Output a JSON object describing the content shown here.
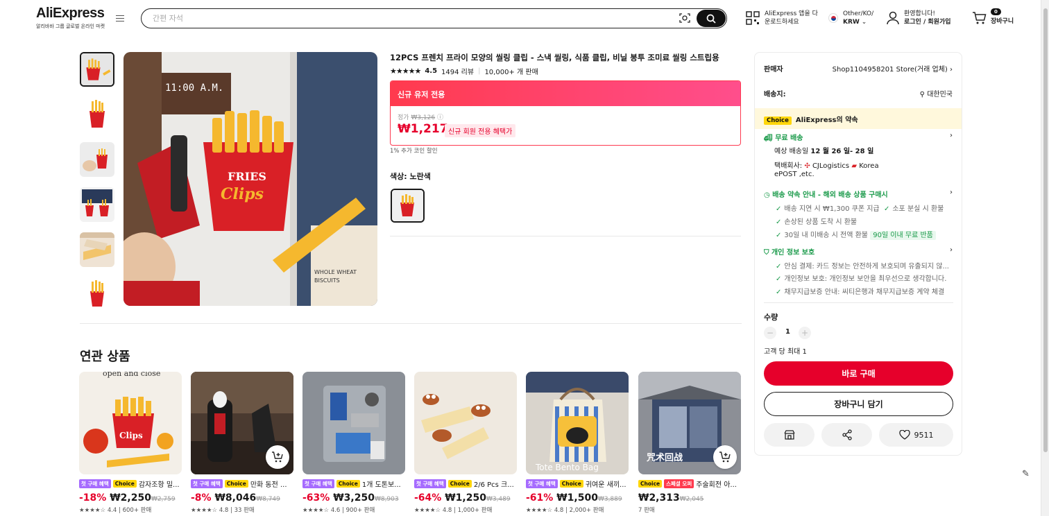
{
  "header": {
    "logo": "AliExpress",
    "logo_sub": "알리바바 그룹 글로벌 온라인 마켓",
    "search_placeholder": "간편 자석",
    "app_line1": "AliExpress 앱을 다",
    "app_line2": "운로드하세요",
    "locale_line1": "Other/KO/",
    "locale_currency": "KRW",
    "welcome": "환영합니다!",
    "login": "로그인 / 회원가입",
    "cart_count": "0",
    "cart_label": "장바구니"
  },
  "product": {
    "title": "12PCS 프렌치 프라이 모양의 씰링 클립 - 스낵 씰링, 식품 클립, 비닐 봉투 조미료 씰링 스트립용",
    "stars": "★★★★★",
    "rating": "4.5",
    "reviews": "1494 리뷰",
    "sold": "10,000+ 개 판매",
    "promo_banner": "신규 유저 전용",
    "orig_label": "정가",
    "orig_price": "₩3,126",
    "price": "₩1,217",
    "price_label": "신규 회원 전용 혜택가",
    "coin_text": "1% 추가 코인 할인",
    "color_label": "색상: 노란색"
  },
  "sidebar": {
    "seller_label": "판매자",
    "seller_value": "Shop1104958201 Store(거래 업체)",
    "shipto_label": "배송지:",
    "shipto_value": "대한민국",
    "choice_badge": "Choice",
    "choice_text": "AliExpress의 약속",
    "free_ship": "무료 배송",
    "delivery_prefix": "예상 배송일",
    "delivery_date": "12 월 26 일- 28 일",
    "courier_label": "택배회사:",
    "courier1": "CJLogistics",
    "courier2": "Korea",
    "courier3": "ePOST ,etc.",
    "guarantee_title": "배송 약속 안내 - 해외 배송 상품 구매시",
    "g1": "배송 지연 시 ₩1,300 쿠폰 지급",
    "g2": "소포 분실 시 환불",
    "g3": "손상된 상품 도착 시 환불",
    "g4": "30일 내 미배송 시 전액 환불",
    "g4_badge": "90일 이내 무료 반품",
    "privacy_title": "개인 정보 보호",
    "p1": "안심 결제: 카드 정보는 안전하게 보호되며 유출되지 않...",
    "p2": "개인정보 보호: 개인정보 보안을 최우선으로 생각합니다.",
    "p3": "채무지급보증 안내: 씨티은행과 채무지급보증 계약 체결",
    "qty_label": "수량",
    "qty_value": "1",
    "max_text": "고객 당 최대 1",
    "buy_now": "바로 구매",
    "add_cart": "장바구니 담기",
    "wishlist_count": "9511"
  },
  "related": {
    "title": "연관 상품",
    "items": [
      {
        "tag1": "첫 구매 혜택",
        "tag2": "Choice",
        "name": "감자조항 밀...",
        "discount": "-18%",
        "price": "₩2,250",
        "orig": "₩2,759",
        "rating": "4.4 | 600+ 판매"
      },
      {
        "tag1": "첫 구매 혜택",
        "tag2": "Choice",
        "name": "만화 동전 ...",
        "discount": "-8%",
        "price": "₩8,046",
        "orig": "₩8,749",
        "rating": "4.8 | 33 판매"
      },
      {
        "tag1": "첫 구매 혜택",
        "tag2": "Choice",
        "name": "1개 도톤보...",
        "discount": "-63%",
        "price": "₩3,250",
        "orig": "₩8,903",
        "rating": "4.6 | 900+ 판매"
      },
      {
        "tag1": "첫 구매 혜택",
        "tag2": "Choice",
        "name": "2/6 Pcs 크...",
        "discount": "-64%",
        "price": "₩1,250",
        "orig": "₩3,489",
        "rating": "4.8 | 1,000+ 판매"
      },
      {
        "tag1": "첫 구매 혜택",
        "tag2": "Choice",
        "name": "귀여운 새끼...",
        "discount": "-61%",
        "price": "₩1,500",
        "orig": "₩3,889",
        "rating": "4.8 | 2,000+ 판매"
      },
      {
        "tag1": "Choice",
        "tag2": "스페셜 오퍼",
        "name": "주술회전 아...",
        "discount": "",
        "price": "₩2,313",
        "orig": "₩2,045",
        "rating": "7 판매"
      }
    ]
  },
  "colors": {
    "accent": "#e6002b",
    "choice": "#ffd60a",
    "green": "#1a9a4a"
  }
}
